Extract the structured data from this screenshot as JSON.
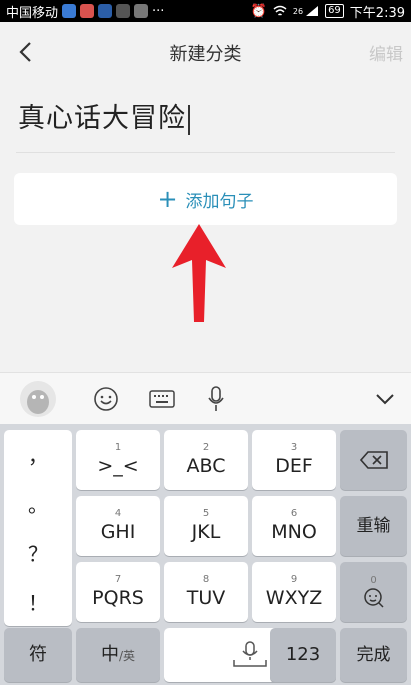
{
  "status_bar": {
    "carrier": "中国移动",
    "network": "26",
    "battery": "69",
    "time": "下午2:39"
  },
  "nav": {
    "title": "新建分类",
    "edit_label": "编辑"
  },
  "category": {
    "name": "真心话大冒险"
  },
  "add_sentence": {
    "label": "添加句子"
  },
  "keyboard": {
    "punctuation": [
      "，",
      "。",
      "？",
      "！"
    ],
    "rows": [
      [
        {
          "num": "1",
          "label": ">_<"
        },
        {
          "num": "2",
          "label": "ABC"
        },
        {
          "num": "3",
          "label": "DEF"
        }
      ],
      [
        {
          "num": "4",
          "label": "GHI"
        },
        {
          "num": "5",
          "label": "JKL"
        },
        {
          "num": "6",
          "label": "MNO"
        }
      ],
      [
        {
          "num": "7",
          "label": "PQRS"
        },
        {
          "num": "8",
          "label": "TUV"
        },
        {
          "num": "9",
          "label": "WXYZ"
        }
      ]
    ],
    "reenter_label": "重输",
    "symbols_label": "符",
    "lang_main": "中",
    "lang_sub": "/英",
    "numbers_label": "123",
    "done_label": "完成",
    "emoji_num": "0"
  },
  "colors": {
    "accent": "#2a8fb8",
    "arrow": "#e8202a"
  }
}
